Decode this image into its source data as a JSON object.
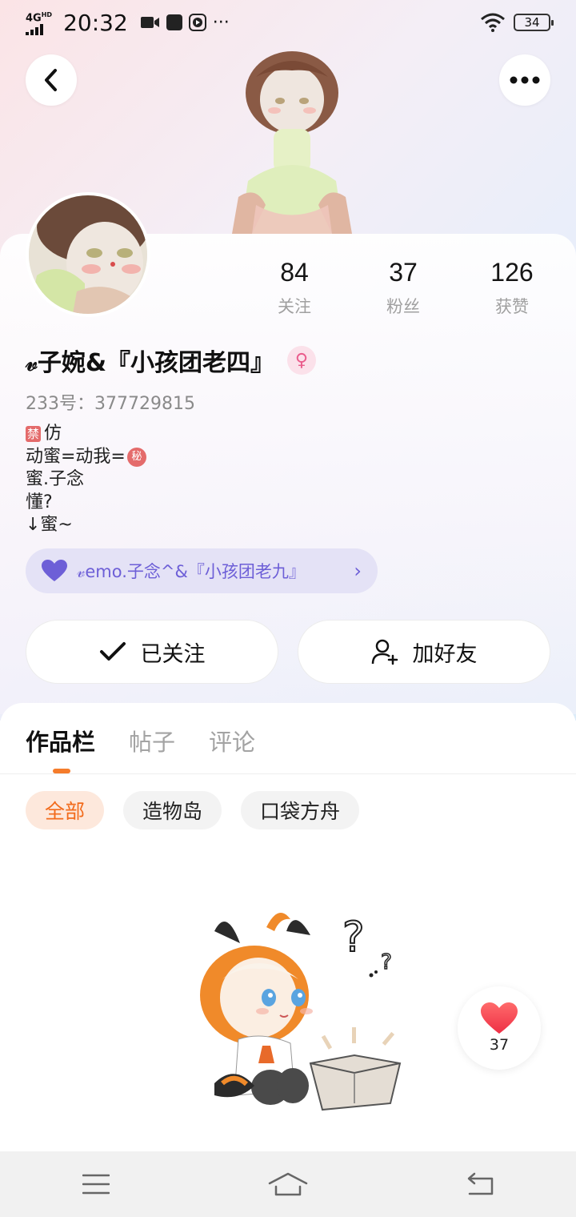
{
  "status_bar": {
    "network": "4G",
    "network_hd": "HD",
    "time": "20:32",
    "dots": "···",
    "battery": "34"
  },
  "header": {
    "back_icon": "chevron-left-icon",
    "more_icon": "more-horizontal-icon"
  },
  "profile": {
    "stats": [
      {
        "value": "84",
        "label": "关注"
      },
      {
        "value": "37",
        "label": "粉丝"
      },
      {
        "value": "126",
        "label": "获赞"
      }
    ],
    "username": "𝓋子婉&『小孩团老四』",
    "gender_icon": "♀",
    "uid": "233号：377729815",
    "bio": {
      "line1_tag": "禁",
      "line1_text": "仿",
      "line2_text": "动蜜=动我=",
      "line2_tag": "秘",
      "line3": "蜜.子念",
      "line4": "懂?",
      "line5": "↓蜜~"
    },
    "relation_text": "𝓋emo.子念^&『小孩团老九』",
    "relation_chevron": "›"
  },
  "actions": {
    "follow_label": "已关注",
    "add_friend_label": "加好友"
  },
  "content": {
    "tabs": [
      {
        "label": "作品栏",
        "active": true
      },
      {
        "label": "帖子",
        "active": false
      },
      {
        "label": "评论",
        "active": false
      }
    ],
    "chips": [
      {
        "label": "全部",
        "active": true
      },
      {
        "label": "造物岛",
        "active": false
      },
      {
        "label": "口袋方舟",
        "active": false
      }
    ]
  },
  "like_fab": {
    "count": "37"
  },
  "colors": {
    "accent": "#f57c2b",
    "relation": "#6d5fd7",
    "like": "#f0454f"
  }
}
